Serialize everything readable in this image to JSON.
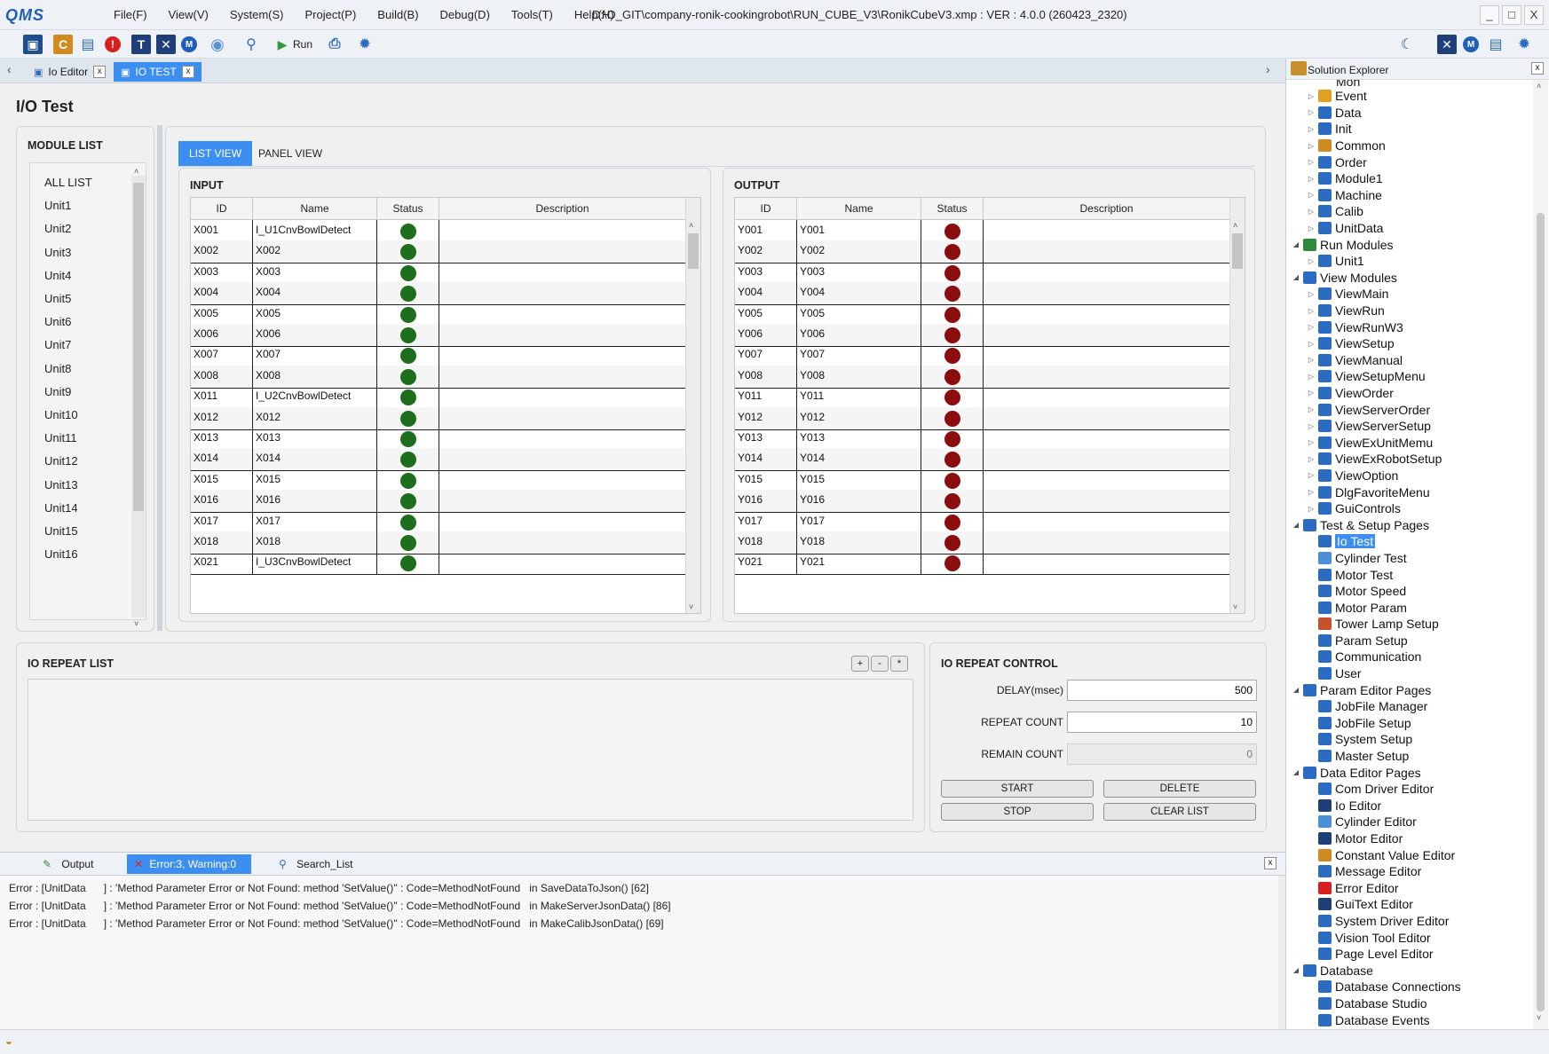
{
  "titlebar": {
    "logo": "QMS",
    "menus": [
      "File(F)",
      "View(V)",
      "System(S)",
      "Project(P)",
      "Build(B)",
      "Debug(D)",
      "Tools(T)",
      "Help(H)"
    ],
    "path": "D:\\O_GIT\\company-ronik-cookingrobot\\RUN_CUBE_V3\\RonikCubeV3.xmp :  VER : 4.0.0 (260423_2320)",
    "minimize": "_",
    "maximize": "□",
    "close": "X"
  },
  "toolbar": {
    "run_label": "Run",
    "icons": [
      "save-icon",
      "constant-icon",
      "message-icon",
      "error-icon",
      "text-icon",
      "io-icon",
      "motor-icon",
      "database-icon",
      "search-icon",
      "run-icon",
      "build-icon",
      "settings-icon",
      "moon-icon"
    ]
  },
  "doctabs": {
    "tabs": [
      {
        "label": "Io Editor",
        "active": false
      },
      {
        "label": "IO TEST",
        "active": true
      }
    ],
    "close": "x"
  },
  "page": {
    "title": "I/O Test",
    "module_list": {
      "title": "MODULE LIST",
      "items": [
        "ALL LIST",
        "Unit1",
        "Unit2",
        "Unit3",
        "Unit4",
        "Unit5",
        "Unit6",
        "Unit7",
        "Unit8",
        "Unit9",
        "Unit10",
        "Unit11",
        "Unit12",
        "Unit13",
        "Unit14",
        "Unit15",
        "Unit16"
      ]
    },
    "view_tabs": [
      {
        "label": "LIST VIEW",
        "active": true
      },
      {
        "label": "PANEL VIEW",
        "active": false
      }
    ],
    "columns": [
      "ID",
      "Name",
      "Status",
      "Description"
    ],
    "input": {
      "title": "INPUT",
      "rows": [
        {
          "id": "X001",
          "name": "I_U1CnvBowlDetect",
          "status": "on",
          "desc": ""
        },
        {
          "id": "X002",
          "name": "X002",
          "status": "on",
          "desc": ""
        },
        {
          "id": "X003",
          "name": "X003",
          "status": "on",
          "desc": ""
        },
        {
          "id": "X004",
          "name": "X004",
          "status": "on",
          "desc": ""
        },
        {
          "id": "X005",
          "name": "X005",
          "status": "on",
          "desc": ""
        },
        {
          "id": "X006",
          "name": "X006",
          "status": "on",
          "desc": ""
        },
        {
          "id": "X007",
          "name": "X007",
          "status": "on",
          "desc": ""
        },
        {
          "id": "X008",
          "name": "X008",
          "status": "on",
          "desc": ""
        },
        {
          "id": "X011",
          "name": "I_U2CnvBowlDetect",
          "status": "on",
          "desc": ""
        },
        {
          "id": "X012",
          "name": "X012",
          "status": "on",
          "desc": ""
        },
        {
          "id": "X013",
          "name": "X013",
          "status": "on",
          "desc": ""
        },
        {
          "id": "X014",
          "name": "X014",
          "status": "on",
          "desc": ""
        },
        {
          "id": "X015",
          "name": "X015",
          "status": "on",
          "desc": ""
        },
        {
          "id": "X016",
          "name": "X016",
          "status": "on",
          "desc": ""
        },
        {
          "id": "X017",
          "name": "X017",
          "status": "on",
          "desc": ""
        },
        {
          "id": "X018",
          "name": "X018",
          "status": "on",
          "desc": ""
        },
        {
          "id": "X021",
          "name": "I_U3CnvBowlDetect",
          "status": "on",
          "desc": ""
        }
      ]
    },
    "output": {
      "title": "OUTPUT",
      "rows": [
        {
          "id": "Y001",
          "name": "Y001",
          "status": "off",
          "desc": ""
        },
        {
          "id": "Y002",
          "name": "Y002",
          "status": "off",
          "desc": ""
        },
        {
          "id": "Y003",
          "name": "Y003",
          "status": "off",
          "desc": ""
        },
        {
          "id": "Y004",
          "name": "Y004",
          "status": "off",
          "desc": ""
        },
        {
          "id": "Y005",
          "name": "Y005",
          "status": "off",
          "desc": ""
        },
        {
          "id": "Y006",
          "name": "Y006",
          "status": "off",
          "desc": ""
        },
        {
          "id": "Y007",
          "name": "Y007",
          "status": "off",
          "desc": ""
        },
        {
          "id": "Y008",
          "name": "Y008",
          "status": "off",
          "desc": ""
        },
        {
          "id": "Y011",
          "name": "Y011",
          "status": "off",
          "desc": ""
        },
        {
          "id": "Y012",
          "name": "Y012",
          "status": "off",
          "desc": ""
        },
        {
          "id": "Y013",
          "name": "Y013",
          "status": "off",
          "desc": ""
        },
        {
          "id": "Y014",
          "name": "Y014",
          "status": "off",
          "desc": ""
        },
        {
          "id": "Y015",
          "name": "Y015",
          "status": "off",
          "desc": ""
        },
        {
          "id": "Y016",
          "name": "Y016",
          "status": "off",
          "desc": ""
        },
        {
          "id": "Y017",
          "name": "Y017",
          "status": "off",
          "desc": ""
        },
        {
          "id": "Y018",
          "name": "Y018",
          "status": "off",
          "desc": ""
        },
        {
          "id": "Y021",
          "name": "Y021",
          "status": "off",
          "desc": ""
        }
      ]
    },
    "repeat_list": {
      "title": "IO REPEAT LIST",
      "buttons": [
        "+",
        "-",
        "*"
      ]
    },
    "repeat_control": {
      "title": "IO REPEAT CONTROL",
      "delay_label": "DELAY(msec)",
      "delay_value": "500",
      "repeat_label": "REPEAT COUNT",
      "repeat_value": "10",
      "remain_label": "REMAIN COUNT",
      "remain_value": "0",
      "start": "START",
      "delete": "DELETE",
      "stop": "STOP",
      "clear": "CLEAR LIST"
    }
  },
  "output_pane": {
    "tabs": [
      "Output",
      "Error:3, Warning:0",
      "Search_List"
    ],
    "close": "x",
    "errors": [
      "Error : [UnitData      ] : 'Method Parameter Error or Not Found: method 'SetValue()'' : Code=MethodNotFound   in SaveDataToJson() [62]",
      "Error : [UnitData      ] : 'Method Parameter Error or Not Found: method 'SetValue()'' : Code=MethodNotFound   in MakeServerJsonData() [86]",
      "Error : [UnitData      ] : 'Method Parameter Error or Not Found: method 'SetValue()'' : Code=MethodNotFound   in MakeCalibJsonData() [69]"
    ]
  },
  "solution_explorer": {
    "title": "Solution Explorer",
    "close": "x",
    "nodes": [
      {
        "label": "Event",
        "level": 2,
        "icon": "event-icon",
        "color": "#e0a020",
        "exp": "▷"
      },
      {
        "label": "Data",
        "level": 2,
        "icon": "data-icon",
        "color": "#2b6bc2",
        "exp": "▷"
      },
      {
        "label": "Init",
        "level": 2,
        "icon": "init-icon",
        "color": "#2b6bc2",
        "exp": "▷"
      },
      {
        "label": "Common",
        "level": 2,
        "icon": "common-icon",
        "color": "#d08a1e",
        "exp": "▷"
      },
      {
        "label": "Order",
        "level": 2,
        "icon": "order-icon",
        "color": "#2b6bc2",
        "exp": "▷"
      },
      {
        "label": "Module1",
        "level": 2,
        "icon": "module-icon",
        "color": "#2b6bc2",
        "exp": "▷"
      },
      {
        "label": "Machine",
        "level": 2,
        "icon": "module-icon",
        "color": "#2b6bc2",
        "exp": "▷"
      },
      {
        "label": "Calib",
        "level": 2,
        "icon": "module-icon",
        "color": "#2b6bc2",
        "exp": "▷"
      },
      {
        "label": "UnitData",
        "level": 2,
        "icon": "module-icon",
        "color": "#2b6bc2",
        "exp": "▷"
      },
      {
        "label": "Run Modules",
        "level": 1,
        "icon": "run-modules-icon",
        "color": "#2e8b3d",
        "exp": "◢"
      },
      {
        "label": "Unit1",
        "level": 2,
        "icon": "module-icon",
        "color": "#2b6bc2",
        "exp": "▷"
      },
      {
        "label": "View Modules",
        "level": 1,
        "icon": "view-modules-icon",
        "color": "#2b6bc2",
        "exp": "◢"
      },
      {
        "label": "ViewMain",
        "level": 2,
        "icon": "view-icon",
        "color": "#2b6bc2",
        "exp": "▷"
      },
      {
        "label": "ViewRun",
        "level": 2,
        "icon": "view-icon",
        "color": "#2b6bc2",
        "exp": "▷"
      },
      {
        "label": "ViewRunW3",
        "level": 2,
        "icon": "view-icon",
        "color": "#2b6bc2",
        "exp": "▷"
      },
      {
        "label": "ViewSetup",
        "level": 2,
        "icon": "view-icon",
        "color": "#2b6bc2",
        "exp": "▷"
      },
      {
        "label": "ViewManual",
        "level": 2,
        "icon": "view-icon",
        "color": "#2b6bc2",
        "exp": "▷"
      },
      {
        "label": "ViewSetupMenu",
        "level": 2,
        "icon": "view-icon",
        "color": "#2b6bc2",
        "exp": "▷"
      },
      {
        "label": "ViewOrder",
        "level": 2,
        "icon": "view-icon",
        "color": "#2b6bc2",
        "exp": "▷"
      },
      {
        "label": "ViewServerOrder",
        "level": 2,
        "icon": "view-icon",
        "color": "#2b6bc2",
        "exp": "▷"
      },
      {
        "label": "ViewServerSetup",
        "level": 2,
        "icon": "view-icon",
        "color": "#2b6bc2",
        "exp": "▷"
      },
      {
        "label": "ViewExUnitMemu",
        "level": 2,
        "icon": "view-icon",
        "color": "#2b6bc2",
        "exp": "▷"
      },
      {
        "label": "ViewExRobotSetup",
        "level": 2,
        "icon": "view-icon",
        "color": "#2b6bc2",
        "exp": "▷"
      },
      {
        "label": "ViewOption",
        "level": 2,
        "icon": "view-icon",
        "color": "#2b6bc2",
        "exp": "▷"
      },
      {
        "label": "DlgFavoriteMenu",
        "level": 2,
        "icon": "view-icon",
        "color": "#2b6bc2",
        "exp": "▷"
      },
      {
        "label": "GuiControls",
        "level": 2,
        "icon": "view-icon",
        "color": "#2b6bc2",
        "exp": "▷"
      },
      {
        "label": "Test & Setup Pages",
        "level": 1,
        "icon": "pages-icon",
        "color": "#2b6bc2",
        "exp": "◢"
      },
      {
        "label": "Io Test",
        "level": 2,
        "icon": "io-test-icon",
        "color": "#2b6bc2",
        "exp": "",
        "selected": true
      },
      {
        "label": "Cylinder Test",
        "level": 2,
        "icon": "cylinder-icon",
        "color": "#4a8fd8",
        "exp": ""
      },
      {
        "label": "Motor Test",
        "level": 2,
        "icon": "motor-icon",
        "color": "#2b6bc2",
        "exp": ""
      },
      {
        "label": "Motor Speed",
        "level": 2,
        "icon": "speed-icon",
        "color": "#2b6bc2",
        "exp": ""
      },
      {
        "label": "Motor Param",
        "level": 2,
        "icon": "motor-param-icon",
        "color": "#2b6bc2",
        "exp": ""
      },
      {
        "label": "Tower Lamp Setup",
        "level": 2,
        "icon": "tower-lamp-icon",
        "color": "#c8502a",
        "exp": ""
      },
      {
        "label": "Param Setup",
        "level": 2,
        "icon": "param-icon",
        "color": "#2b6bc2",
        "exp": ""
      },
      {
        "label": "Communication",
        "level": 2,
        "icon": "communication-icon",
        "color": "#2b6bc2",
        "exp": ""
      },
      {
        "label": "User",
        "level": 2,
        "icon": "user-icon",
        "color": "#2b6bc2",
        "exp": ""
      },
      {
        "label": "Param Editor Pages",
        "level": 1,
        "icon": "pages-icon",
        "color": "#2b6bc2",
        "exp": "◢"
      },
      {
        "label": "JobFile Manager",
        "level": 2,
        "icon": "file-icon",
        "color": "#2b6bc2",
        "exp": ""
      },
      {
        "label": "JobFile Setup",
        "level": 2,
        "icon": "file-icon",
        "color": "#2b6bc2",
        "exp": ""
      },
      {
        "label": "System Setup",
        "level": 2,
        "icon": "file-icon",
        "color": "#2b6bc2",
        "exp": ""
      },
      {
        "label": "Master Setup",
        "level": 2,
        "icon": "file-icon",
        "color": "#2b6bc2",
        "exp": ""
      },
      {
        "label": "Data Editor Pages",
        "level": 1,
        "icon": "check-folder-icon",
        "color": "#2b6bc2",
        "exp": "◢"
      },
      {
        "label": "Com Driver Editor",
        "level": 2,
        "icon": "com-driver-icon",
        "color": "#2b6bc2",
        "exp": ""
      },
      {
        "label": "Io Editor",
        "level": 2,
        "icon": "io-icon",
        "color": "#1f3f78",
        "exp": ""
      },
      {
        "label": "Cylinder Editor",
        "level": 2,
        "icon": "cylinder-icon",
        "color": "#4a8fd8",
        "exp": ""
      },
      {
        "label": "Motor Editor",
        "level": 2,
        "icon": "motor-icon",
        "color": "#1f3f78",
        "exp": ""
      },
      {
        "label": "Constant Value Editor",
        "level": 2,
        "icon": "constant-icon",
        "color": "#d08a1e",
        "exp": ""
      },
      {
        "label": "Message Editor",
        "level": 2,
        "icon": "message-icon",
        "color": "#2b6bc2",
        "exp": ""
      },
      {
        "label": "Error Editor",
        "level": 2,
        "icon": "error-icon",
        "color": "#d62020",
        "exp": ""
      },
      {
        "label": "GuiText Editor",
        "level": 2,
        "icon": "text-icon",
        "color": "#1f3f78",
        "exp": ""
      },
      {
        "label": "System Driver Editor",
        "level": 2,
        "icon": "gear-icon",
        "color": "#2b6bc2",
        "exp": ""
      },
      {
        "label": "Vision Tool Editor",
        "level": 2,
        "icon": "vision-icon",
        "color": "#2b6bc2",
        "exp": ""
      },
      {
        "label": "Page Level Editor",
        "level": 2,
        "icon": "user-icon",
        "color": "#2b6bc2",
        "exp": ""
      },
      {
        "label": "Database",
        "level": 1,
        "icon": "check-folder-icon",
        "color": "#2b6bc2",
        "exp": "◢"
      },
      {
        "label": "Database Connections",
        "level": 2,
        "icon": "cube-icon",
        "color": "#2b6bc2",
        "exp": ""
      },
      {
        "label": "Database Studio",
        "level": 2,
        "icon": "cube-icon",
        "color": "#2b6bc2",
        "exp": ""
      },
      {
        "label": "Database Events",
        "level": 2,
        "icon": "cube-icon",
        "color": "#2b6bc2",
        "exp": ""
      }
    ]
  },
  "colors": {
    "accent": "#3c8ff0",
    "status_on": "#1d6e1d",
    "status_off": "#8b0d0d",
    "error_tab": "#3c8ff0"
  }
}
